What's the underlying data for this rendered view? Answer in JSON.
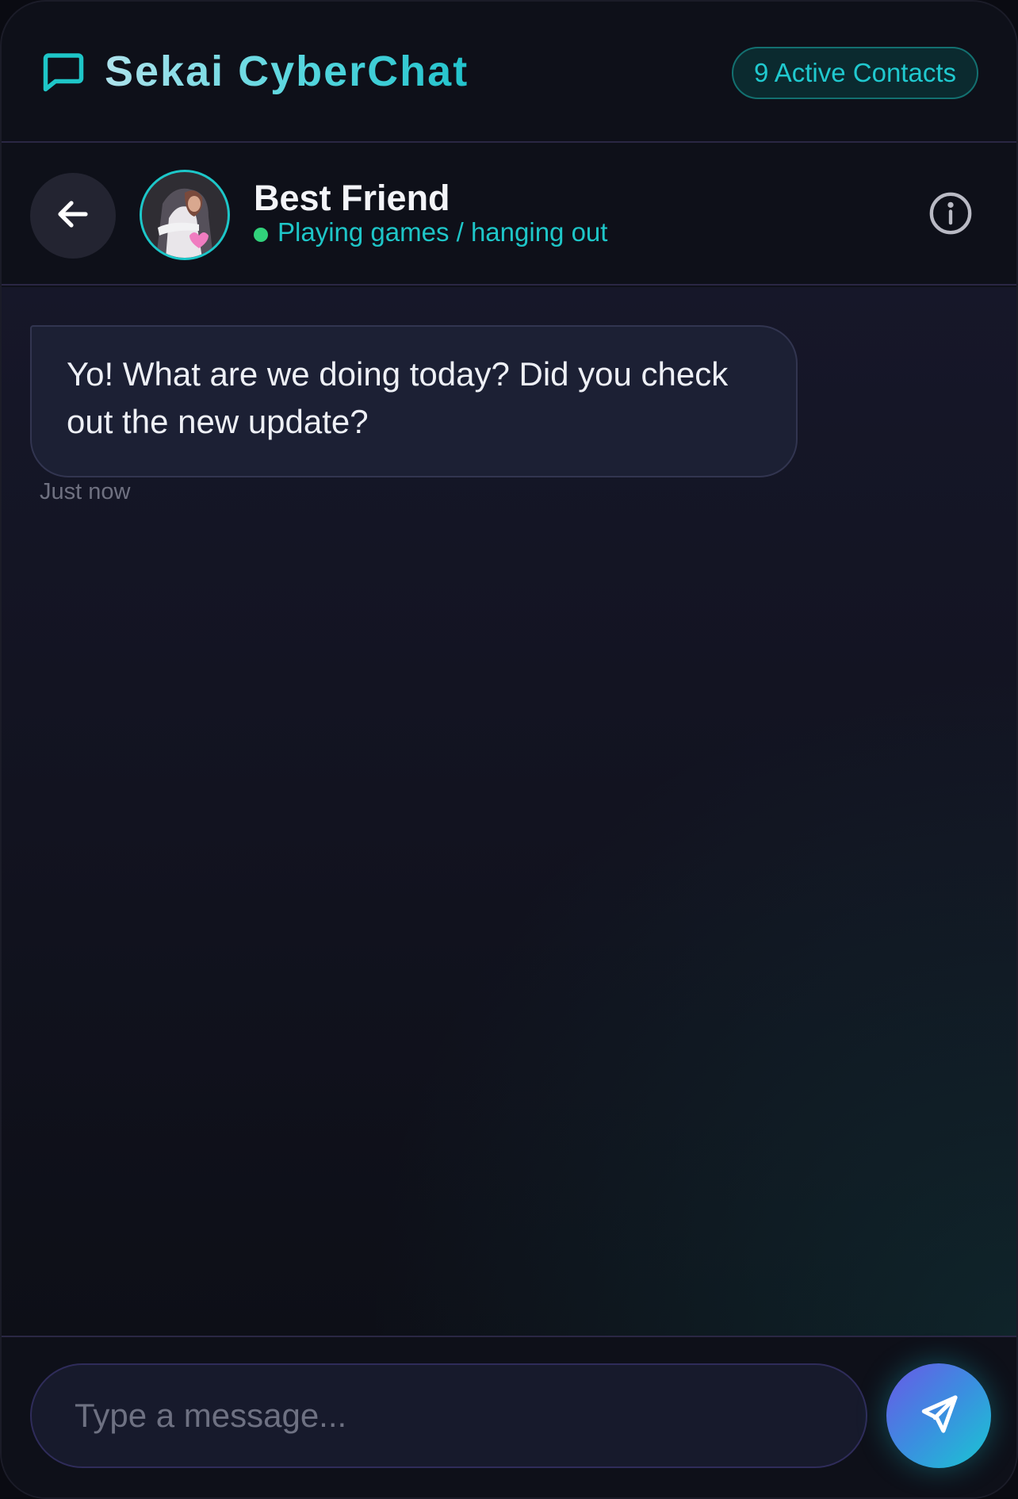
{
  "app": {
    "title": "Sekai CyberChat",
    "active_contacts": "9 Active Contacts",
    "brand_icon": "message-square-icon",
    "accent_color": "#1ec6c8"
  },
  "contact": {
    "name": "Best Friend",
    "status": "Playing games / hanging out",
    "status_color": "#31d27b",
    "avatar_icon": "anime-character-avatar"
  },
  "messages": [
    {
      "sender": "Best Friend",
      "text": "Yo! What are we doing today? Did you check out the new update?",
      "time": "Just now"
    }
  ],
  "composer": {
    "placeholder": "Type a message...",
    "value": ""
  },
  "icons": {
    "back": "arrow-left-icon",
    "info": "info-icon",
    "send": "send-icon"
  }
}
